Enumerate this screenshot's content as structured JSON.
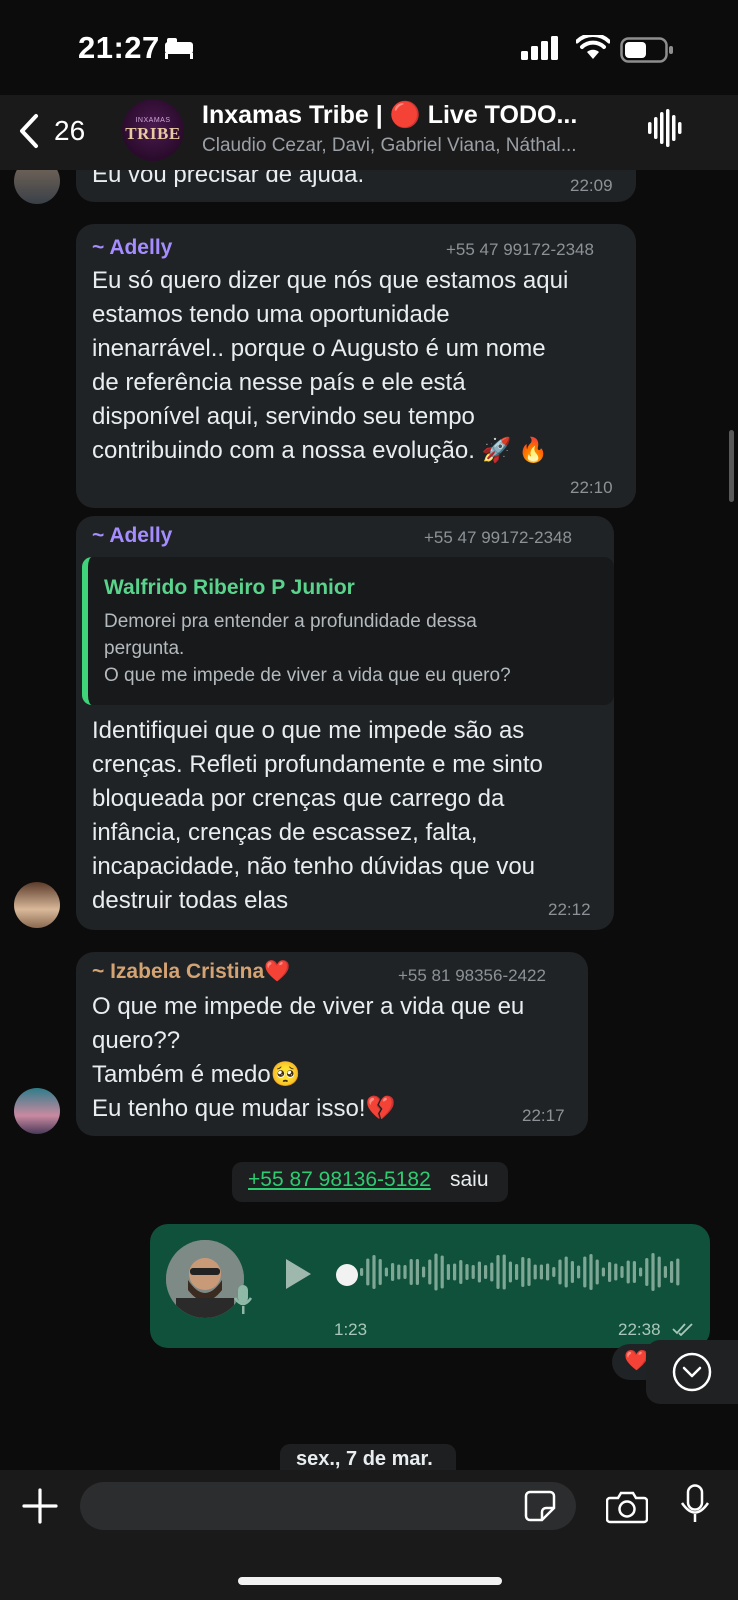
{
  "status_bar": {
    "time": "21:27"
  },
  "header": {
    "back_count": "26",
    "avatar_small": "INXAMAS",
    "avatar_big": "TRIBE",
    "title": "Inxamas Tribe | 🔴 Live TODO...",
    "members": "Claudio Cezar, Davi, Gabriel Viana, Náthal..."
  },
  "messages": [
    {
      "text": "Eu vou precisar de ajuda.",
      "time": "22:09"
    },
    {
      "sender": "~ Adelly",
      "phone": "+55 47 99172-2348",
      "lines": [
        "Eu só quero dizer que nós que estamos aqui",
        "estamos tendo uma oportunidade",
        "inenarrável.. porque o Augusto é um nome",
        "de referência nesse país e ele está",
        "disponível aqui, servindo seu tempo",
        "contribuindo com a nossa evolução. 🚀 🔥"
      ],
      "time": "22:10"
    },
    {
      "sender": "~ Adelly",
      "phone": "+55 47 99172-2348",
      "quote_author": "Walfrido Ribeiro P Junior",
      "quote_lines": [
        "Demorei pra entender a profundidade dessa",
        "pergunta.",
        "O que me impede de viver a vida que eu quero?"
      ],
      "lines": [
        "Identifiquei que o que me impede são as",
        "crenças. Refleti profundamente e me sinto",
        "bloqueada por crenças que carrego da",
        "infância, crenças de escassez, falta,",
        "incapacidade, não tenho dúvidas que vou",
        "destruir todas elas"
      ],
      "time": "22:12"
    },
    {
      "sender": "~ Izabela Cristina❤️",
      "phone": "+55 81 98356-2422",
      "lines": [
        "O que me impede de viver a vida que eu",
        "quero??",
        "Também é medo🥺",
        "Eu tenho que mudar isso!💔"
      ],
      "time": "22:17"
    }
  ],
  "system": {
    "link": "+55 87 98136-5182",
    "rest": "saiu"
  },
  "voice": {
    "duration": "1:23",
    "time": "22:38"
  },
  "reaction": "❤️",
  "date_separator": "sex., 7 de mar.",
  "input": {
    "placeholder": ""
  },
  "colors": {
    "adelly": "#a58cff",
    "izabela": "#d4a373",
    "quote_author": "#5ad48d",
    "outgoing_bubble": "#10513b",
    "incoming_bubble": "#202325"
  }
}
